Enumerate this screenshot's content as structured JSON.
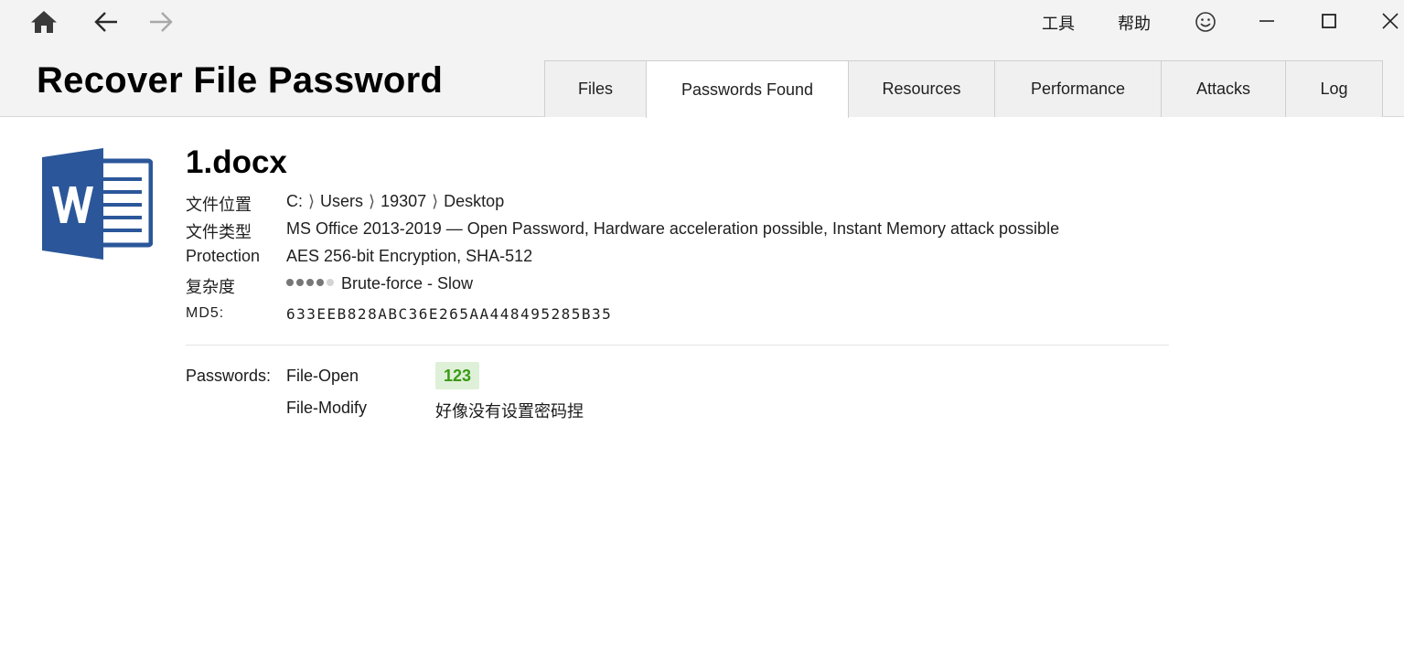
{
  "nav": {
    "home_icon": "home-icon",
    "back_icon": "arrow-left-icon",
    "forward_icon": "arrow-right-icon"
  },
  "menu": {
    "tools": "工具",
    "help": "帮助",
    "feedback_icon": "smiley-icon"
  },
  "window_controls": {
    "minimize_icon": "minimize-icon",
    "maximize_icon": "maximize-icon",
    "close_icon": "close-icon"
  },
  "app_title": "Recover File Password",
  "tabs": [
    {
      "label": "Files",
      "active": false
    },
    {
      "label": "Passwords Found",
      "active": true
    },
    {
      "label": "Resources",
      "active": false
    },
    {
      "label": "Performance",
      "active": false
    },
    {
      "label": "Attacks",
      "active": false
    },
    {
      "label": "Log",
      "active": false
    }
  ],
  "file": {
    "icon": "word-document-icon",
    "name": "1.docx",
    "location": {
      "label": "文件位置",
      "parts": [
        "C:",
        "Users",
        "19307",
        "Desktop"
      ],
      "separator": "⟩"
    },
    "type": {
      "label": "文件类型",
      "value": "MS Office 2013-2019 — Open Password, Hardware acceleration possible, Instant Memory attack possible"
    },
    "protection": {
      "label": "Protection",
      "value": "AES 256-bit Encryption, SHA-512"
    },
    "complexity": {
      "label": "复杂度",
      "level": 4,
      "max": 5,
      "value": "Brute-force - Slow"
    },
    "md5": {
      "label": "MD5:",
      "value": "633EEB828ABC36E265AA448495285B35"
    }
  },
  "passwords": {
    "label": "Passwords:",
    "open": {
      "kind": "File-Open",
      "value": "123"
    },
    "modify": {
      "kind": "File-Modify",
      "value": "好像没有设置密码捏"
    }
  },
  "colors": {
    "word_blue": "#2b579a",
    "badge_bg": "#dff0d8",
    "badge_text": "#3a9a14"
  }
}
